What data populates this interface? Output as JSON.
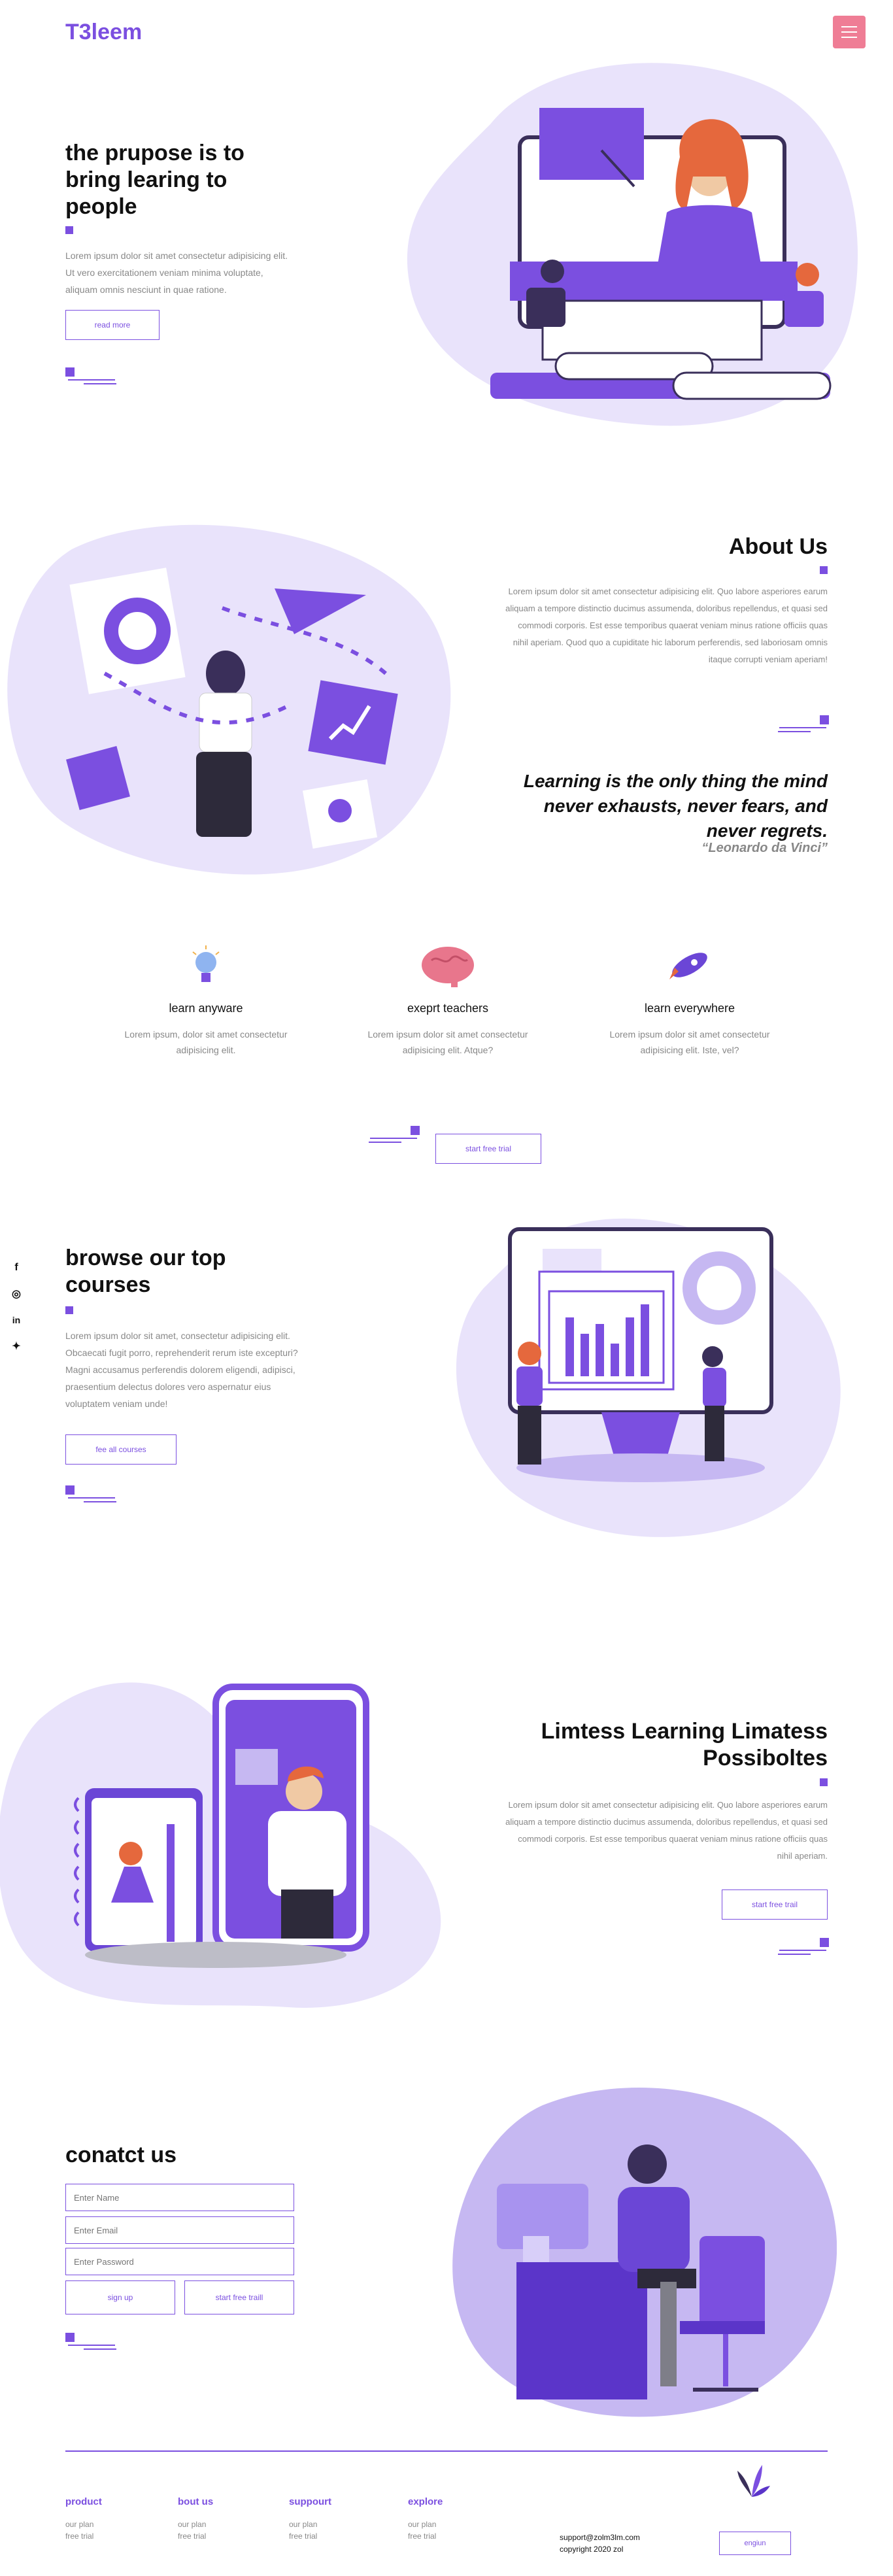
{
  "header": {
    "logo": "T3leem",
    "menu_icon": "hamburger-icon"
  },
  "hero": {
    "title": "the prupose is to bring learing to people",
    "text": "Lorem ipsum dolor sit amet consectetur adipisicing elit. Ut vero exercitationem veniam minima voluptate, aliquam omnis nesciunt in quae ratione.",
    "button": "read more"
  },
  "about": {
    "title": "About Us",
    "text": "Lorem ipsum dolor sit amet consectetur adipisicing elit. Quo labore asperiores earum aliquam a tempore distinctio ducimus assumenda, doloribus repellendus, et quasi sed commodi corporis. Est esse temporibus quaerat veniam minus ratione officiis quas nihil aperiam. Quod quo a cupiditate hic laborum perferendis, sed laboriosam omnis itaque corrupti veniam aperiam!",
    "quote": "Learning is the only thing the mind never exhausts, never fears, and never regrets.",
    "author": "“Leonardo da Vinci”"
  },
  "features": [
    {
      "icon": "lightbulb-icon",
      "title": "learn anyware",
      "desc": "Lorem ipsum, dolor sit amet consectetur adipisicing elit."
    },
    {
      "icon": "brain-icon",
      "title": "exeprt teachers",
      "desc": "Lorem ipsum dolor sit amet consectetur adipisicing elit. Atque?"
    },
    {
      "icon": "rocket-icon",
      "title": "learn everywhere",
      "desc": "Lorem ipsum dolor sit amet consectetur adipisicing elit. Iste, vel?"
    }
  ],
  "features_button": "start free trial",
  "social": [
    {
      "icon": "facebook-icon",
      "glyph": "f"
    },
    {
      "icon": "instagram-icon",
      "glyph": "◎"
    },
    {
      "icon": "linkedin-icon",
      "glyph": "in"
    },
    {
      "icon": "twitter-icon",
      "glyph": "✦"
    }
  ],
  "courses": {
    "title": "browse our top courses",
    "text": "Lorem ipsum dolor sit amet, consectetur adipisicing elit. Obcaecati fugit porro, reprehenderit rerum iste excepturi? Magni accusamus perferendis dolorem eligendi, adipisci, praesentium delectus dolores vero aspernatur eius voluptatem veniam unde!",
    "button": "fee all courses"
  },
  "limitless": {
    "title": "Limtess Learning Limatess Possiboltes",
    "text": "Lorem ipsum dolor sit amet consectetur adipisicing elit. Quo labore asperiores earum aliquam a tempore distinctio ducimus assumenda, doloribus repellendus, et quasi sed commodi corporis. Est esse temporibus quaerat veniam minus ratione officiis quas nihil aperiam.",
    "button": "start free trail"
  },
  "contact": {
    "title": "conatct us",
    "name_placeholder": "Enter Name",
    "email_placeholder": "Enter Email",
    "password_placeholder": "Enter Password",
    "signup": "sign up",
    "trial": "start free traill"
  },
  "footer": {
    "columns": [
      {
        "title": "product",
        "items": [
          "our plan",
          "free trial"
        ]
      },
      {
        "title": "bout us",
        "items": [
          "our plan",
          "free trial"
        ]
      },
      {
        "title": "suppourt",
        "items": [
          "our plan",
          "free trial"
        ]
      },
      {
        "title": "explore",
        "items": [
          "our plan",
          "free trial"
        ]
      }
    ],
    "email": "support@zolm3lm.com",
    "copyright": "copyright 2020 zol",
    "button": "engiun"
  },
  "colors": {
    "accent": "#7b4fe0",
    "menu": "#ef7d95",
    "blob": "#e9e3fb"
  }
}
